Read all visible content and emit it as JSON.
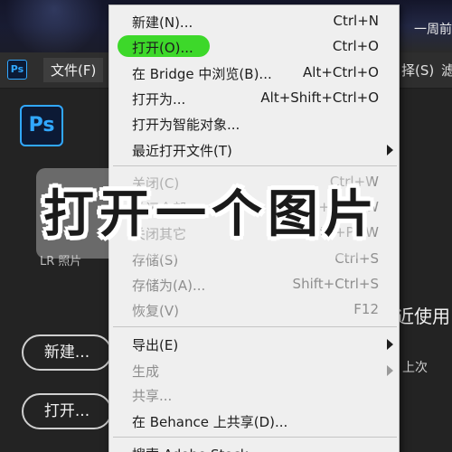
{
  "top": {
    "right_text": "一周前"
  },
  "menubar": {
    "app_icon": "Ps",
    "file_menu": "文件(F)",
    "right_partial_1": "择(S)",
    "right_partial_2": "滤"
  },
  "home": {
    "logo": "Ps",
    "lr_label": "LR 照片",
    "recent_title": "近使用",
    "recent_sub": "上次",
    "new_button": "新建...",
    "open_button": "打开..."
  },
  "file_menu_items": [
    {
      "label": "新建(N)...",
      "shortcut": "Ctrl+N",
      "enabled": true
    },
    {
      "label": "打开(O)...",
      "shortcut": "Ctrl+O",
      "enabled": true
    },
    {
      "label": "在 Bridge 中浏览(B)...",
      "shortcut": "Alt+Ctrl+O",
      "enabled": true
    },
    {
      "label": "打开为...",
      "shortcut": "Alt+Shift+Ctrl+O",
      "enabled": true
    },
    {
      "label": "打开为智能对象...",
      "shortcut": "",
      "enabled": true
    },
    {
      "label": "最近打开文件(T)",
      "shortcut": "",
      "enabled": true,
      "submenu": true
    },
    {
      "label": "关闭(C)",
      "shortcut": "Ctrl+W",
      "enabled": false
    },
    {
      "label": "关闭全部",
      "shortcut": "Alt+Ctrl+W",
      "enabled": false
    },
    {
      "label": "关闭其它",
      "shortcut": "Alt+Ctrl+P+W",
      "enabled": false
    },
    {
      "label": "存储(S)",
      "shortcut": "Ctrl+S",
      "enabled": false
    },
    {
      "label": "存储为(A)...",
      "shortcut": "Shift+Ctrl+S",
      "enabled": false
    },
    {
      "label": "恢复(V)",
      "shortcut": "F12",
      "enabled": false
    },
    {
      "label": "导出(E)",
      "shortcut": "",
      "enabled": true,
      "submenu": true
    },
    {
      "label": "生成",
      "shortcut": "",
      "enabled": false,
      "submenu": true
    },
    {
      "label": "共享...",
      "shortcut": "",
      "enabled": false
    },
    {
      "label": "在 Behance 上共享(D)...",
      "shortcut": "",
      "enabled": true
    },
    {
      "label": "搜索 Adobe Stock...",
      "shortcut": "",
      "enabled": true
    }
  ],
  "overlay_caption": "打开一个图片",
  "colors": {
    "highlight": "#33d61f",
    "ps_blue": "#31a8ff",
    "menu_bg": "#efefef"
  }
}
